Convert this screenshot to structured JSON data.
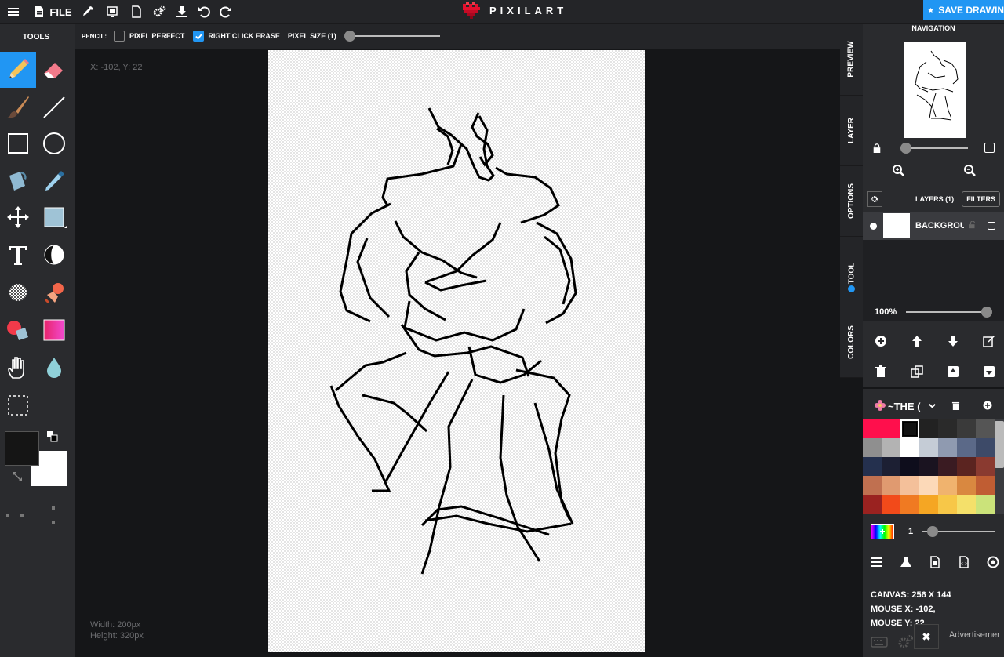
{
  "topbar": {
    "file_label": "FILE",
    "logo_text": "PIXILART",
    "save_label": "SAVE DRAWIN"
  },
  "tools": {
    "title": "TOOLS",
    "items": [
      "pencil",
      "eraser",
      "brush",
      "line",
      "rectangle",
      "ellipse",
      "bucket-fill",
      "eyedropper",
      "move",
      "select-shape",
      "text",
      "lighten-darken",
      "dither",
      "stamp",
      "color-replace",
      "gradient",
      "pan",
      "blur",
      "marquee-select"
    ],
    "primary_color": "#151515",
    "secondary_color": "#ffffff"
  },
  "options": {
    "tool_label": "PENCIL:",
    "pixel_perfect_label": "PIXEL PERFECT",
    "pixel_perfect_checked": false,
    "right_click_erase_label": "RIGHT CLICK ERASE",
    "right_click_erase_checked": true,
    "pixel_size_label": "PIXEL SIZE (1)",
    "pixel_size_value": 1
  },
  "workspace": {
    "coords": "X: -102, Y: 22",
    "width_label": "Width: 200px",
    "height_label": "Height: 320px"
  },
  "side_tabs": [
    "PREVIEW",
    "LAYER",
    "OPTIONS",
    "TOOL",
    "COLORS"
  ],
  "navigation": {
    "title": "NAVIGATION"
  },
  "layers": {
    "title": "LAYERS (1)",
    "filters_label": "FILTERS",
    "items": [
      {
        "name": "BACKGROUI"
      }
    ],
    "opacity_label": "100%",
    "opacity_value": 100
  },
  "palette": {
    "name": "~THE (",
    "colors": [
      "#ff0f4c",
      "#ff0f4c",
      "#111111",
      "#222222",
      "#2a2a2a",
      "#3a3a3a",
      "#555555",
      "#8f8f8f",
      "#b3b3b3",
      "#ffffff",
      "#c5ccd6",
      "#8f9ab0",
      "#5b6988",
      "#3d4a68",
      "#24304e",
      "#1c1f33",
      "#0e0d1c",
      "#1a1320",
      "#3a1b22",
      "#5b2420",
      "#8a3a30",
      "#c07050",
      "#e09a70",
      "#f4c09a",
      "#fcd9b8",
      "#f0b36e",
      "#d98840",
      "#c05d33",
      "#9a2220",
      "#f24a1a",
      "#f07a22",
      "#f5a623",
      "#f7c748",
      "#f4e06a",
      "#cbe37a"
    ],
    "brush_size_label": "1"
  },
  "stats": {
    "canvas": "CANVAS: 256 X 144",
    "mouse_x": "MOUSE X: -102,",
    "mouse_y": "MOUSE Y: 22"
  },
  "ad": {
    "label": "Advertisemer",
    "close_label": "✖"
  }
}
